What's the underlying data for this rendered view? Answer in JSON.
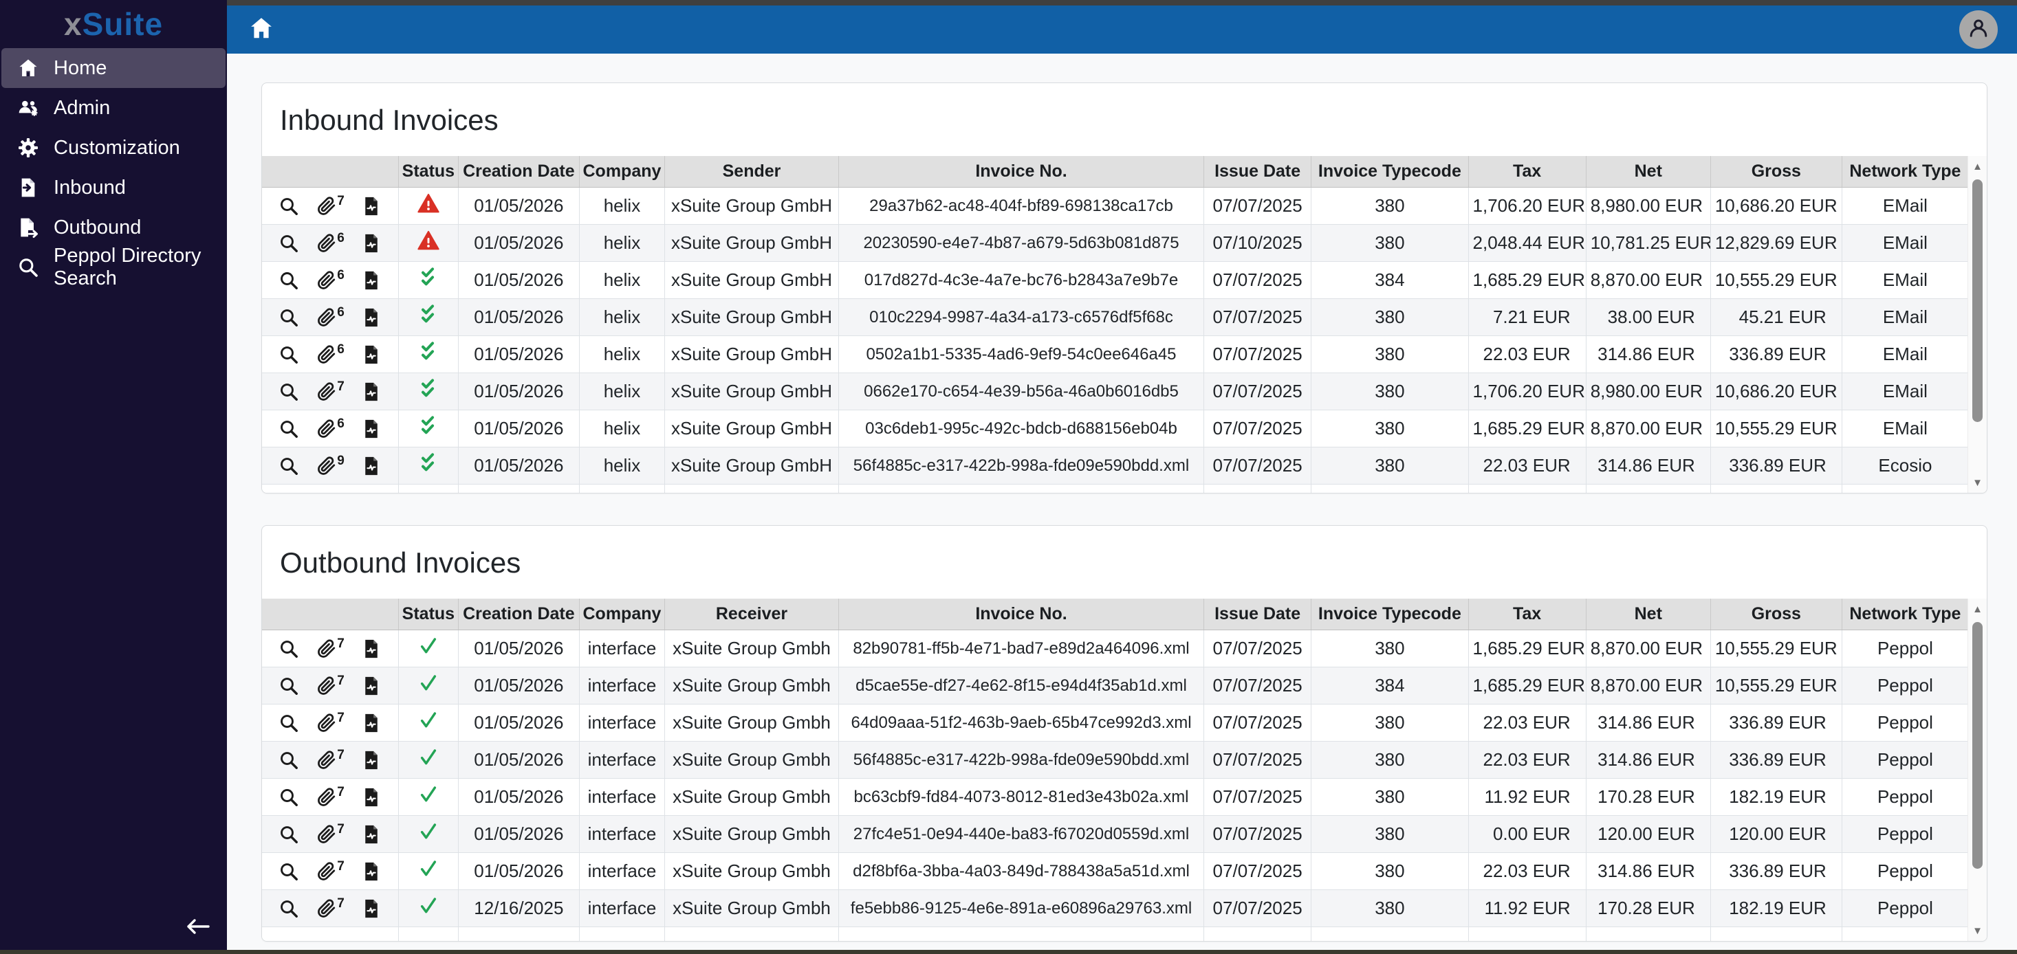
{
  "sidebar": {
    "logo_x": "x",
    "logo_suite": "Suite",
    "items": [
      {
        "label": "Home",
        "icon": "home-icon",
        "active": true
      },
      {
        "label": "Admin",
        "icon": "admin-users-icon",
        "active": false
      },
      {
        "label": "Customization",
        "icon": "gear-icon",
        "active": false
      },
      {
        "label": "Inbound",
        "icon": "inbound-document-icon",
        "active": false
      },
      {
        "label": "Outbound",
        "icon": "outbound-document-icon",
        "active": false
      },
      {
        "label": "Peppol Directory Search",
        "icon": "search-icon",
        "active": false
      }
    ]
  },
  "colors": {
    "topbar": "#1160a6",
    "sidebar": "#161031",
    "sidebar_active": "#4e4862",
    "status_error": "#d93025",
    "status_ok": "#23a455",
    "header_bg": "#e0e0e0"
  },
  "tables": {
    "inbound": {
      "title": "Inbound Invoices",
      "ok_icon": "double-check-icon",
      "columns": [
        "",
        "Status",
        "Creation Date",
        "Company",
        "Sender",
        "Invoice No.",
        "Issue Date",
        "Invoice Typecode",
        "Tax",
        "Net",
        "Gross",
        "Network Type"
      ],
      "rows": [
        {
          "attachments": "7",
          "status": "error",
          "creation_date": "01/05/2026",
          "company": "helix",
          "party": "xSuite Group GmbH",
          "invoice_no": "29a37b62-ac48-404f-bf89-698138ca17cb",
          "issue_date": "07/07/2025",
          "typecode": "380",
          "tax": "1,706.20 EUR",
          "net": "8,980.00 EUR",
          "gross": "10,686.20 EUR",
          "network": "EMail"
        },
        {
          "attachments": "6",
          "status": "error",
          "creation_date": "01/05/2026",
          "company": "helix",
          "party": "xSuite Group GmbH",
          "invoice_no": "20230590-e4e7-4b87-a679-5d63b081d875",
          "issue_date": "07/10/2025",
          "typecode": "380",
          "tax": "2,048.44 EUR",
          "net": "10,781.25 EUR",
          "gross": "12,829.69 EUR",
          "network": "EMail"
        },
        {
          "attachments": "6",
          "status": "ok",
          "creation_date": "01/05/2026",
          "company": "helix",
          "party": "xSuite Group GmbH",
          "invoice_no": "017d827d-4c3e-4a7e-bc76-b2843a7e9b7e",
          "issue_date": "07/07/2025",
          "typecode": "384",
          "tax": "1,685.29 EUR",
          "net": "8,870.00 EUR",
          "gross": "10,555.29 EUR",
          "network": "EMail"
        },
        {
          "attachments": "6",
          "status": "ok",
          "creation_date": "01/05/2026",
          "company": "helix",
          "party": "xSuite Group GmbH",
          "invoice_no": "010c2294-9987-4a34-a173-c6576df5f68c",
          "issue_date": "07/07/2025",
          "typecode": "380",
          "tax": "7.21 EUR",
          "net": "38.00 EUR",
          "gross": "45.21 EUR",
          "network": "EMail"
        },
        {
          "attachments": "6",
          "status": "ok",
          "creation_date": "01/05/2026",
          "company": "helix",
          "party": "xSuite Group GmbH",
          "invoice_no": "0502a1b1-5335-4ad6-9ef9-54c0ee646a45",
          "issue_date": "07/07/2025",
          "typecode": "380",
          "tax": "22.03 EUR",
          "net": "314.86 EUR",
          "gross": "336.89 EUR",
          "network": "EMail"
        },
        {
          "attachments": "7",
          "status": "ok",
          "creation_date": "01/05/2026",
          "company": "helix",
          "party": "xSuite Group GmbH",
          "invoice_no": "0662e170-c654-4e39-b56a-46a0b6016db5",
          "issue_date": "07/07/2025",
          "typecode": "380",
          "tax": "1,706.20 EUR",
          "net": "8,980.00 EUR",
          "gross": "10,686.20 EUR",
          "network": "EMail"
        },
        {
          "attachments": "6",
          "status": "ok",
          "creation_date": "01/05/2026",
          "company": "helix",
          "party": "xSuite Group GmbH",
          "invoice_no": "03c6deb1-995c-492c-bdcb-d688156eb04b",
          "issue_date": "07/07/2025",
          "typecode": "380",
          "tax": "1,685.29 EUR",
          "net": "8,870.00 EUR",
          "gross": "10,555.29 EUR",
          "network": "EMail"
        },
        {
          "attachments": "9",
          "status": "ok",
          "creation_date": "01/05/2026",
          "company": "helix",
          "party": "xSuite Group GmbH",
          "invoice_no": "56f4885c-e317-422b-998a-fde09e590bdd.xml",
          "issue_date": "07/07/2025",
          "typecode": "380",
          "tax": "22.03 EUR",
          "net": "314.86 EUR",
          "gross": "336.89 EUR",
          "network": "Ecosio"
        }
      ]
    },
    "outbound": {
      "title": "Outbound Invoices",
      "ok_icon": "check-icon",
      "columns": [
        "",
        "Status",
        "Creation Date",
        "Company",
        "Receiver",
        "Invoice No.",
        "Issue Date",
        "Invoice Typecode",
        "Tax",
        "Net",
        "Gross",
        "Network Type"
      ],
      "rows": [
        {
          "attachments": "7",
          "status": "ok",
          "creation_date": "01/05/2026",
          "company": "interface",
          "party": "xSuite Group Gmbh",
          "invoice_no": "82b90781-ff5b-4e71-bad7-e89d2a464096.xml",
          "issue_date": "07/07/2025",
          "typecode": "380",
          "tax": "1,685.29 EUR",
          "net": "8,870.00 EUR",
          "gross": "10,555.29 EUR",
          "network": "Peppol"
        },
        {
          "attachments": "7",
          "status": "ok",
          "creation_date": "01/05/2026",
          "company": "interface",
          "party": "xSuite Group Gmbh",
          "invoice_no": "d5cae55e-df27-4e62-8f15-e94d4f35ab1d.xml",
          "issue_date": "07/07/2025",
          "typecode": "384",
          "tax": "1,685.29 EUR",
          "net": "8,870.00 EUR",
          "gross": "10,555.29 EUR",
          "network": "Peppol"
        },
        {
          "attachments": "7",
          "status": "ok",
          "creation_date": "01/05/2026",
          "company": "interface",
          "party": "xSuite Group Gmbh",
          "invoice_no": "64d09aaa-51f2-463b-9aeb-65b47ce992d3.xml",
          "issue_date": "07/07/2025",
          "typecode": "380",
          "tax": "22.03 EUR",
          "net": "314.86 EUR",
          "gross": "336.89 EUR",
          "network": "Peppol"
        },
        {
          "attachments": "7",
          "status": "ok",
          "creation_date": "01/05/2026",
          "company": "interface",
          "party": "xSuite Group Gmbh",
          "invoice_no": "56f4885c-e317-422b-998a-fde09e590bdd.xml",
          "issue_date": "07/07/2025",
          "typecode": "380",
          "tax": "22.03 EUR",
          "net": "314.86 EUR",
          "gross": "336.89 EUR",
          "network": "Peppol"
        },
        {
          "attachments": "7",
          "status": "ok",
          "creation_date": "01/05/2026",
          "company": "interface",
          "party": "xSuite Group Gmbh",
          "invoice_no": "bc63cbf9-fd84-4073-8012-81ed3e43b02a.xml",
          "issue_date": "07/07/2025",
          "typecode": "380",
          "tax": "11.92 EUR",
          "net": "170.28 EUR",
          "gross": "182.19 EUR",
          "network": "Peppol"
        },
        {
          "attachments": "7",
          "status": "ok",
          "creation_date": "01/05/2026",
          "company": "interface",
          "party": "xSuite Group Gmbh",
          "invoice_no": "27fc4e51-0e94-440e-ba83-f67020d0559d.xml",
          "issue_date": "07/07/2025",
          "typecode": "380",
          "tax": "0.00 EUR",
          "net": "120.00 EUR",
          "gross": "120.00 EUR",
          "network": "Peppol"
        },
        {
          "attachments": "7",
          "status": "ok",
          "creation_date": "01/05/2026",
          "company": "interface",
          "party": "xSuite Group Gmbh",
          "invoice_no": "d2f8bf6a-3bba-4a03-849d-788438a5a51d.xml",
          "issue_date": "07/07/2025",
          "typecode": "380",
          "tax": "22.03 EUR",
          "net": "314.86 EUR",
          "gross": "336.89 EUR",
          "network": "Peppol"
        },
        {
          "attachments": "7",
          "status": "ok",
          "creation_date": "12/16/2025",
          "company": "interface",
          "party": "xSuite Group Gmbh",
          "invoice_no": "fe5ebb86-9125-4e6e-891a-e60896a29763.xml",
          "issue_date": "07/07/2025",
          "typecode": "380",
          "tax": "11.92 EUR",
          "net": "170.28 EUR",
          "gross": "182.19 EUR",
          "network": "Peppol"
        }
      ]
    }
  }
}
